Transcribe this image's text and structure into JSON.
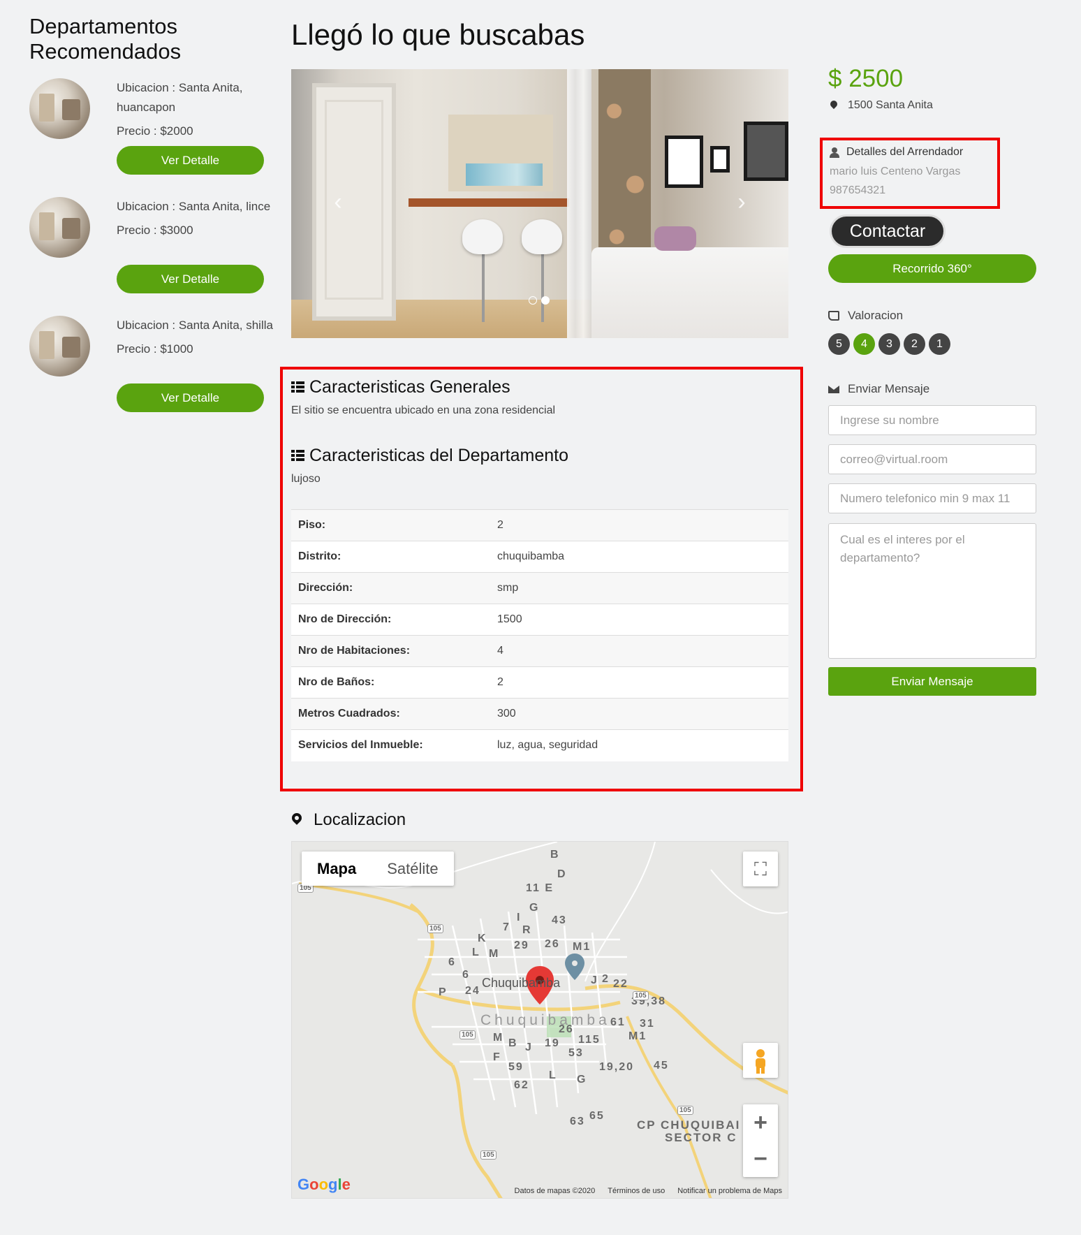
{
  "sidebar": {
    "title": "Departamentos Recomendados",
    "items": [
      {
        "ubicacion": "Ubicacion : Santa Anita, huancapon",
        "precio": "Precio : $2000",
        "button": "Ver Detalle"
      },
      {
        "ubicacion": "Ubicacion : Santa Anita, lince",
        "precio": "Precio : $3000",
        "button": "Ver Detalle"
      },
      {
        "ubicacion": "Ubicacion : Santa Anita, shilla",
        "precio": "Precio : $1000",
        "button": "Ver Detalle"
      }
    ]
  },
  "main": {
    "heading": "Llegó lo que buscabas",
    "carousel": {
      "prev": "‹",
      "next": "›"
    },
    "general": {
      "title": "Caracteristicas Generales",
      "text": "El sitio se encuentra ubicado en una zona residencial"
    },
    "department": {
      "title": "Caracteristicas del Departamento",
      "text": "lujoso"
    },
    "specs": [
      {
        "k": "Piso:",
        "v": "2"
      },
      {
        "k": "Distrito:",
        "v": "chuquibamba"
      },
      {
        "k": "Dirección:",
        "v": "smp"
      },
      {
        "k": "Nro de Dirección:",
        "v": "1500"
      },
      {
        "k": "Nro de Habitaciones:",
        "v": "4"
      },
      {
        "k": "Nro de Baños:",
        "v": "2"
      },
      {
        "k": "Metros Cuadrados:",
        "v": "300"
      },
      {
        "k": "Servicios del Inmueble:",
        "v": "luz, agua, seguridad"
      }
    ],
    "location": {
      "title": "Localizacion",
      "map": {
        "tab_map": "Mapa",
        "tab_sat": "Satélite",
        "town_label": "Chuquibamba",
        "town_big": "Chuquibamba",
        "cp_1": "CP CHUQUIBAI",
        "cp_2": "SECTOR C",
        "google": "Google",
        "footer": [
          "Datos de mapas ©2020",
          "Términos de uso",
          "Notificar un problema de Maps"
        ],
        "zoom_in": "+",
        "zoom_out": "−",
        "fullscreen": "⛶",
        "labels": [
          "B",
          "D",
          "11 E",
          "G",
          "43",
          "I",
          "7",
          "R",
          "K",
          "29",
          "26",
          "M1",
          "L",
          "M",
          "6",
          "6",
          "J",
          "2",
          "22",
          "P",
          "24",
          "39,38",
          "61",
          "31",
          "26",
          "115",
          "M1",
          "M",
          "B",
          "J",
          "19",
          "53",
          "F",
          "59",
          "19,20",
          "45",
          "L",
          "G",
          "62",
          "63",
          "65"
        ],
        "roads": [
          "105",
          "105",
          "105",
          "105",
          "105",
          "105"
        ]
      }
    }
  },
  "right": {
    "price": "$ 2500",
    "address": "1500 Santa Anita",
    "landlord": {
      "title": "Detalles del Arrendador",
      "name": "mario luis Centeno Vargas",
      "phone": "987654321"
    },
    "contact": "Contactar",
    "tour": "Recorrido 360°",
    "rating_title": "Valoracion",
    "rating": [
      "5",
      "4",
      "3",
      "2",
      "1"
    ],
    "rating_selected": "4",
    "message_title": "Enviar Mensaje",
    "name_placeholder": "Ingrese su nombre",
    "email_placeholder": "correo@virtual.room",
    "phone_placeholder": "Numero telefonico min 9 max 11",
    "interest_placeholder": "Cual es el interes por el departamento?",
    "send": "Enviar Mensaje"
  },
  "colors": {
    "accent": "#5aa30f",
    "highlight": "#ef0000",
    "dark": "#2b2b2b"
  }
}
